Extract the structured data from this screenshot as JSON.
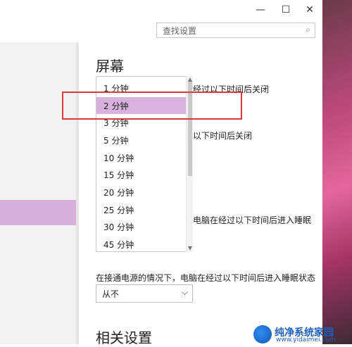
{
  "window_controls": {
    "minimize": "—",
    "maximize": "☐",
    "close": "✕"
  },
  "search": {
    "placeholder": "查找设置",
    "icon": "⌕"
  },
  "screen": {
    "heading": "屏幕",
    "battery_off_text": "经过以下时间后关闭",
    "plugged_off_text": "以下时间后关闭"
  },
  "sleep": {
    "battery_text": "电脑在经过以下时间后进入睡眠",
    "plugged_text": "在接通电源的情况下，电脑在经过以下时间后进入睡眠状态",
    "plugged_value": "从不"
  },
  "dropdown": {
    "items": [
      "1 分钟",
      "2 分钟",
      "3 分钟",
      "5 分钟",
      "10 分钟",
      "15 分钟",
      "20 分钟",
      "25 分钟",
      "30 分钟",
      "45 分钟"
    ],
    "selected_index": 1
  },
  "related_heading": "相关设置",
  "watermark": {
    "title": "纯净系统家园",
    "url": "www.yidaimei.com"
  },
  "colors": {
    "selected": "#d8b1dc",
    "highlight": "#d93b3b",
    "left_active": "#d6afdb"
  }
}
